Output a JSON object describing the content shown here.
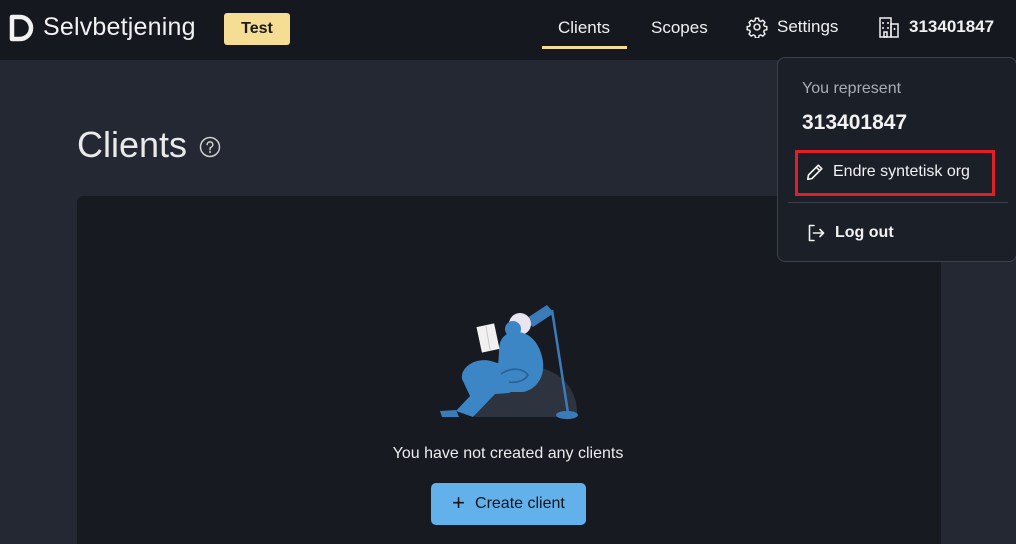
{
  "header": {
    "app_name": "Selvbetjening",
    "environment_badge": "Test",
    "logo_icon": "d-logo-icon",
    "nav": {
      "clients": "Clients",
      "scopes": "Scopes",
      "settings": "Settings",
      "org_number": "313401847"
    },
    "active_tab": "Clients",
    "accent_color": "#f6dd94"
  },
  "main": {
    "title": "Clients",
    "empty_state_text": "You have not created any clients",
    "create_button_label": "Create client",
    "create_button_color": "#63b1ea"
  },
  "dropdown": {
    "caption": "You represent",
    "org_number": "313401847",
    "edit_label": "Endre syntetisk org",
    "logout_label": "Log out",
    "highlight_color": "#e01f26"
  }
}
